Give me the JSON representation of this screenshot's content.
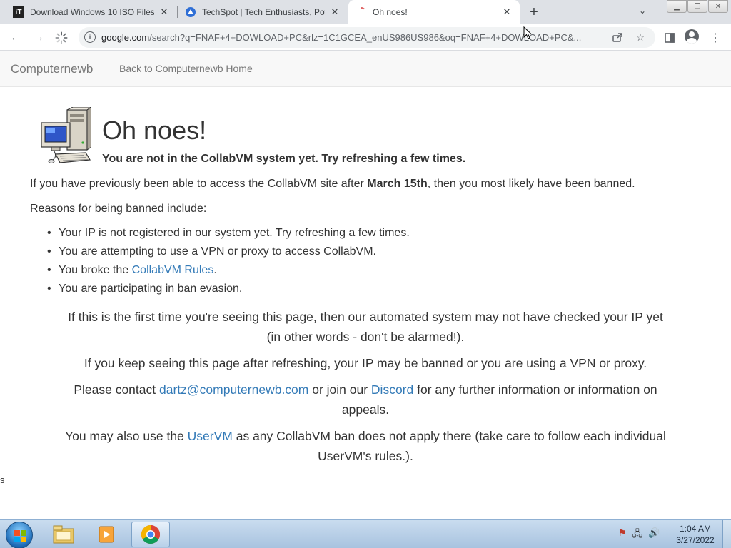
{
  "browser": {
    "tabs": [
      {
        "title": "Download Windows 10 ISO Files",
        "favicon": "iT",
        "active": false
      },
      {
        "title": "TechSpot | Tech Enthusiasts, Pow",
        "favicon": "techspot-icon",
        "active": false
      },
      {
        "title": "Oh noes!",
        "favicon": "loading-icon",
        "active": true
      }
    ],
    "url_host": "google.com",
    "url_rest": "/search?q=FNAF+4+DOWLOAD+PC&rlz=1C1GCEA_enUS986US986&oq=FNAF+4+DOWLOAD+PC&..."
  },
  "navbar": {
    "brand": "Computernewb",
    "link": "Back to Computernewb Home"
  },
  "main": {
    "heading": "Oh noes!",
    "subheading": "You are not in the CollabVM system yet. Try refreshing a few times.",
    "intro_pre": "If you have previously been able to access the CollabVM site after ",
    "intro_bold": "March 15th",
    "intro_post": ", then you most likely have been banned.",
    "reasons_title": "Reasons for being banned include:",
    "reasons": [
      "Your IP is not registered in our system yet. Try refreshing a few times.",
      "You are attempting to use a VPN or proxy to access CollabVM.",
      "You broke the ",
      "You are participating in ban evasion."
    ],
    "rules_link": "CollabVM Rules",
    "rules_suffix": ".",
    "first_time_line1": "If this is the first time you're seeing this page, then our automated system may not have checked your IP yet",
    "first_time_line2": "(in other words - don't be alarmed!).",
    "keep_seeing": "If you keep seeing this page after refreshing, your IP may be banned or you are using a VPN or proxy.",
    "contact_pre": "Please contact ",
    "contact_email": "dartz@computernewb.com",
    "contact_mid": " or join our ",
    "contact_discord": "Discord",
    "contact_post_line1": " for any further information or information on",
    "contact_post_line2": "appeals.",
    "uservm_pre": "You may also use the ",
    "uservm_link": "UserVM",
    "uservm_post_line1": " as any CollabVM ban does not apply there (take care to follow each individual",
    "uservm_post_line2": "UserVM's rules.).",
    "stray": "s"
  },
  "taskbar": {
    "apps": [
      "explorer-icon",
      "media-player-icon",
      "chrome-icon"
    ],
    "time": "1:04 AM",
    "date": "3/27/2022"
  },
  "colors": {
    "link": "#337ab7",
    "text": "#333333",
    "navbar_bg": "#f8f8f8"
  }
}
